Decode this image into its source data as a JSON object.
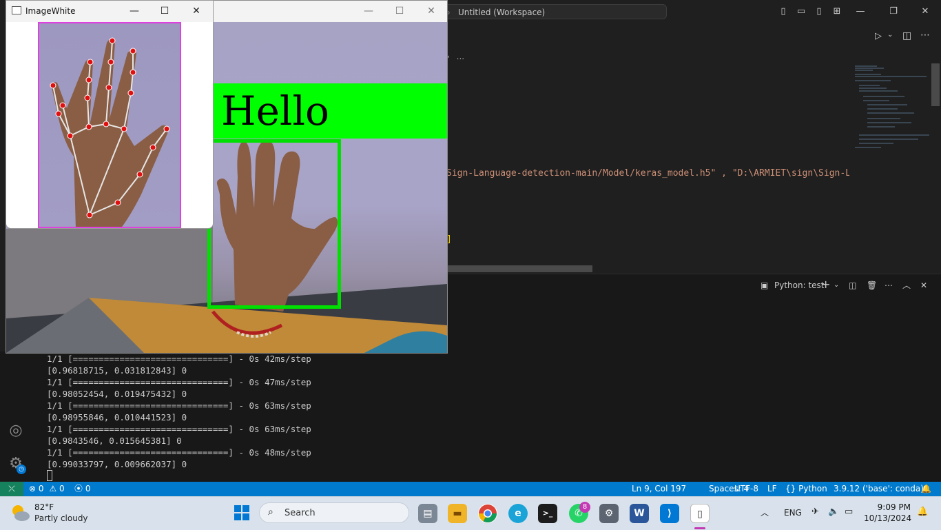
{
  "vscode": {
    "search_text": "Untitled (Workspace)",
    "breadcrumb": "...",
    "code_line_1": "Sign-Language-detection-main/Model/keras_model.h5\" , \"D:\\ARMIET\\sign\\Sign-La",
    "code_line_2": "]",
    "terminal_tab": "Python: test",
    "terminal_lines": [
      "1/1 [==============================] - 0s 42ms/step",
      "[0.96818715, 0.031812843] 0",
      "1/1 [==============================] - 0s 47ms/step",
      "[0.98052454, 0.019475432] 0",
      "1/1 [==============================] - 0s 63ms/step",
      "[0.98955846, 0.010441523] 0",
      "1/1 [==============================] - 0s 63ms/step",
      "[0.9843546, 0.015645381] 0",
      "1/1 [==============================] - 0s 48ms/step",
      "[0.99033797, 0.009662037] 0"
    ],
    "status": {
      "errors": "0",
      "warnings": "0",
      "ports": "0",
      "position": "Ln 9, Col 197",
      "spaces": "Spaces: 4",
      "encoding": "UTF-8",
      "eol": "LF",
      "language": "Python",
      "interpreter": "3.9.12 ('base': conda)"
    },
    "accent_color": "#007acc"
  },
  "image_window": {
    "title": "ImageWhite",
    "border_color": "#e040e0",
    "landmark_color": "#e01010"
  },
  "camera_window": {
    "prediction_label": "Hello",
    "label_bg_color": "#00ff00"
  },
  "taskbar": {
    "weather_temp": "82°F",
    "weather_desc": "Partly cloudy",
    "search_label": "Search",
    "whatsapp_badge": "8",
    "language": "ENG",
    "time": "9:09 PM",
    "date": "10/13/2024"
  }
}
